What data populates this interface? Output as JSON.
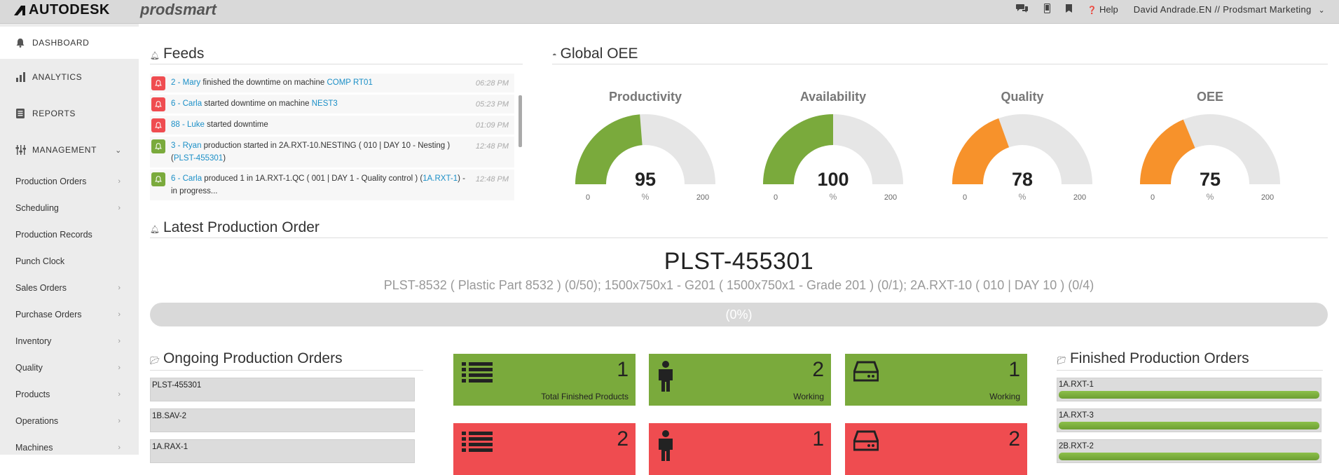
{
  "topbar": {
    "brand": "AUTODESK",
    "product": "prodsmart",
    "help": "Help",
    "user": "David Andrade.EN // Prodsmart Marketing"
  },
  "sidebar": {
    "main": [
      {
        "label": "DASHBOARD",
        "icon": "bell-icon"
      },
      {
        "label": "ANALYTICS",
        "icon": "bar-chart-icon"
      },
      {
        "label": "REPORTS",
        "icon": "report-icon"
      },
      {
        "label": "MANAGEMENT",
        "icon": "sliders-icon"
      }
    ],
    "items": [
      "Production Orders",
      "Scheduling",
      "Production Records",
      "Punch Clock",
      "Sales Orders",
      "Purchase Orders",
      "Inventory",
      "Quality",
      "Products",
      "Operations",
      "Machines"
    ]
  },
  "feeds": {
    "title": "Feeds",
    "items": [
      {
        "status": "red",
        "user": "2 - Mary",
        "text": " finished the downtime on machine ",
        "link": "COMP RT01",
        "time": "06:28 PM"
      },
      {
        "status": "red",
        "user": "6 - Carla",
        "text": " started downtime on machine ",
        "link": "NEST3",
        "time": "05:23 PM"
      },
      {
        "status": "red",
        "user": "88 - Luke",
        "text": " started downtime",
        "link": "",
        "time": "01:09 PM"
      },
      {
        "status": "green",
        "user": "3 - Ryan",
        "text": " production started in 2A.RXT-10.NESTING ( 010 | DAY 10 - Nesting ) (",
        "link": "PLST-455301",
        "after": ")",
        "time": "12:48 PM"
      },
      {
        "status": "green",
        "user": "6 - Carla",
        "text": " produced 1 in 1A.RXT-1.QC ( 001 | DAY 1 - Quality control ) (",
        "link": "1A.RXT-1",
        "after": ") - in progress...",
        "time": "12:48 PM"
      }
    ]
  },
  "oee": {
    "title": "Global OEE",
    "gauges": [
      {
        "label": "Productivity",
        "value": 95,
        "unit": "%",
        "min": "0",
        "max": "200",
        "color": "#7aaa3c"
      },
      {
        "label": "Availability",
        "value": 100,
        "unit": "%",
        "min": "0",
        "max": "200",
        "color": "#7aaa3c"
      },
      {
        "label": "Quality",
        "value": 78,
        "unit": "%",
        "min": "0",
        "max": "200",
        "color": "#f7922b"
      },
      {
        "label": "OEE",
        "value": 75,
        "unit": "%",
        "min": "0",
        "max": "200",
        "color": "#f7922b"
      }
    ]
  },
  "latest": {
    "title": "Latest Production Order",
    "code": "PLST-455301",
    "description": "PLST-8532 ( Plastic Part 8532 ) (0/50); 1500x750x1 - G201 ( 1500x750x1 - Grade 201 ) (0/1); 2A.RXT-10 ( 010 | DAY 10 ) (0/4)",
    "progress_text": "(0%)",
    "progress": 0
  },
  "ongoing": {
    "title": "Ongoing Production Orders",
    "items": [
      "PLST-455301",
      "1B.SAV-2",
      "1A.RAX-1"
    ]
  },
  "tiles": [
    {
      "value": "1",
      "label": "Total Finished Products",
      "color": "#7aaa3c",
      "icon": "list-icon"
    },
    {
      "value": "2",
      "label": "Working",
      "color": "#7aaa3c",
      "icon": "person-icon"
    },
    {
      "value": "1",
      "label": "Working",
      "color": "#7aaa3c",
      "icon": "machine-icon"
    },
    {
      "value": "2",
      "label": "",
      "color": "#ef4c50",
      "icon": "list-icon"
    },
    {
      "value": "1",
      "label": "",
      "color": "#ef4c50",
      "icon": "person-icon"
    },
    {
      "value": "2",
      "label": "",
      "color": "#ef4c50",
      "icon": "machine-icon"
    }
  ],
  "finished": {
    "title": "Finished Production Orders",
    "items": [
      {
        "code": "1A.RXT-1",
        "progress": 1.0
      },
      {
        "code": "1A.RXT-3",
        "progress": 1.0
      },
      {
        "code": "2B.RXT-2",
        "progress": 1.0
      }
    ]
  }
}
